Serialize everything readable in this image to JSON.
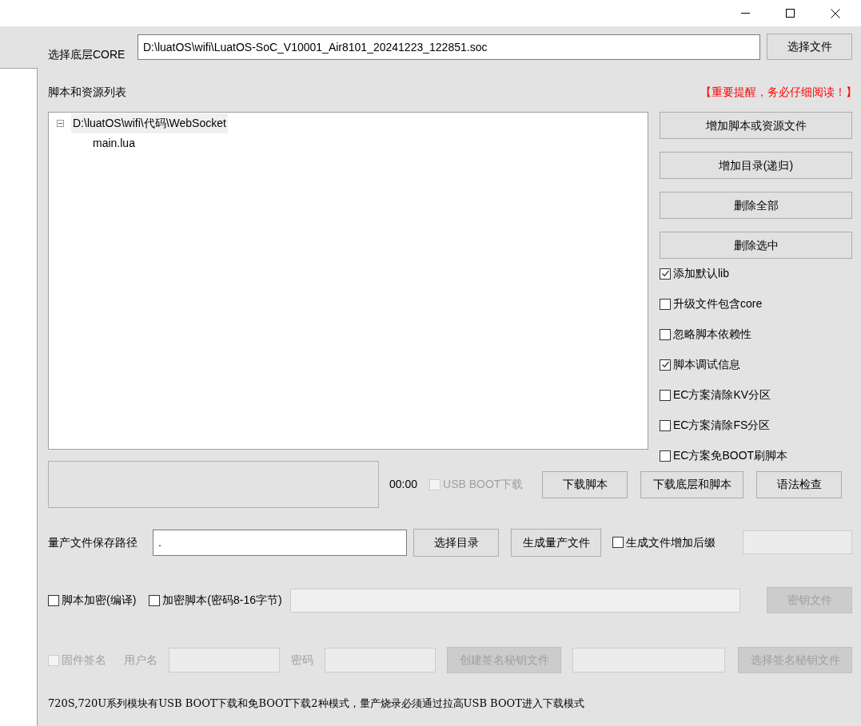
{
  "core": {
    "label": "选择底层CORE",
    "value": "D:\\luatOS\\wifi\\LuatOS-SoC_V10001_Air8101_20241223_122851.soc",
    "button": "选择文件"
  },
  "script_list": {
    "label": "脚本和资源列表",
    "notice": "【重要提醒，务必仔细阅读！】",
    "tree": [
      {
        "label": "D:\\luatOS\\wifi\\代码\\WebSocket",
        "expanded": true,
        "selected": true,
        "children": [
          {
            "label": "main.lua",
            "selected": false
          }
        ]
      }
    ]
  },
  "actions": [
    "增加脚本或资源文件",
    "增加目录(递归)",
    "删除全部",
    "删除选中"
  ],
  "options": [
    {
      "label": "添加默认lib",
      "checked": true
    },
    {
      "label": "升级文件包含core",
      "checked": false
    },
    {
      "label": "忽略脚本依赖性",
      "checked": false
    },
    {
      "label": "脚本调试信息",
      "checked": true
    },
    {
      "label": "EC方案清除KV分区",
      "checked": false
    },
    {
      "label": "EC方案清除FS分区",
      "checked": false
    },
    {
      "label": "EC方案免BOOT刷脚本",
      "checked": false
    }
  ],
  "download": {
    "time": "00:00",
    "usb_boot": {
      "label": "USB BOOT下载",
      "checked": false,
      "disabled": true
    },
    "buttons": [
      "下载脚本",
      "下载底层和脚本",
      "语法检查"
    ]
  },
  "production": {
    "label": "量产文件保存路径",
    "path": ".",
    "buttons": [
      "选择目录",
      "生成量产文件"
    ],
    "suffix": {
      "label": "生成文件增加后缀",
      "checked": false
    },
    "suffix_field_disabled": true
  },
  "encryption": {
    "options": [
      {
        "label": "脚本加密(编译)",
        "checked": false
      },
      {
        "label": "加密脚本(密码8-16字节)",
        "checked": false
      }
    ],
    "key_button": {
      "label": "密钥文件",
      "disabled": true
    }
  },
  "signing": {
    "disabled": true,
    "checkbox": {
      "label": "固件签名",
      "checked": false
    },
    "username_label": "用户名",
    "password_label": "密码",
    "create_button": "创建签名秘钥文件",
    "select_button": "选择签名秘钥文件"
  },
  "note": "720S,720U系列模块有USB BOOT下载和免BOOT下载2种模式，量产烧录必须通过拉高USB BOOT进入下载模式"
}
